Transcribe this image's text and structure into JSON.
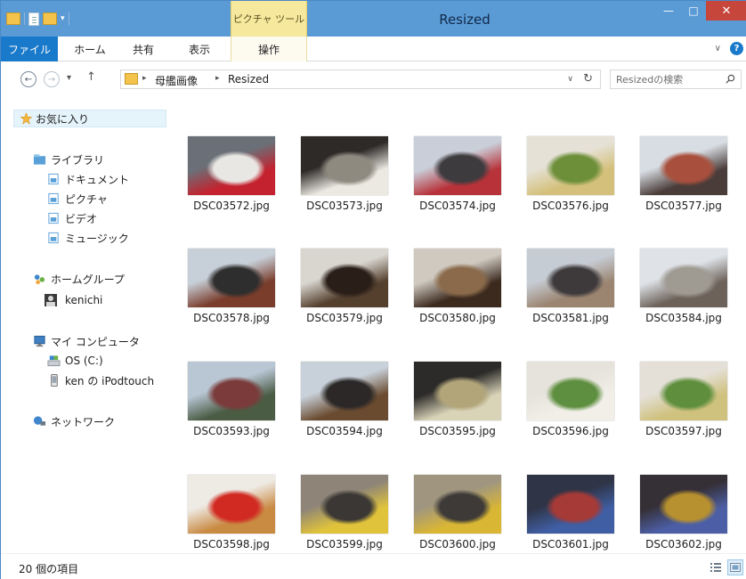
{
  "window": {
    "title": "Resized",
    "tool_tab": "ピクチャ ツール",
    "buttons": {
      "minimize": "—",
      "maximize": "□",
      "close": "✕"
    }
  },
  "ribbon": {
    "tabs": [
      "ファイル",
      "ホーム",
      "共有",
      "表示",
      "操作"
    ],
    "active_tool_tab": "操作",
    "expand": "∨",
    "help": "?"
  },
  "nav": {
    "back": "←",
    "forward": "→",
    "recent": "▾",
    "up": "↑",
    "breadcrumb": [
      "母艦画像",
      "Resized"
    ],
    "breadcrumb_sep": "▸",
    "dropdown": "∨",
    "refresh": "↻",
    "search_placeholder": "Resizedの検索"
  },
  "sidebar": {
    "favorites": "お気に入り",
    "library": "ライブラリ",
    "library_items": [
      "ドキュメント",
      "ピクチャ",
      "ビデオ",
      "ミュージック"
    ],
    "homegroup": "ホームグループ",
    "homegroup_user": "kenichi",
    "computer": "マイ コンピュータ",
    "computer_items": [
      "OS (C:)",
      "ken の iPodtouch"
    ],
    "network": "ネットワーク"
  },
  "files": [
    {
      "name": "DSC03572.jpg",
      "c1": "#6b7078",
      "c2": "#c4222e",
      "c3": "#e9e7e3"
    },
    {
      "name": "DSC03573.jpg",
      "c1": "#2d2a28",
      "c2": "#ece9e2",
      "c3": "#8f8a80"
    },
    {
      "name": "DSC03574.jpg",
      "c1": "#c9ced8",
      "c2": "#b8323a",
      "c3": "#3d3b3e"
    },
    {
      "name": "DSC03576.jpg",
      "c1": "#e5e1d6",
      "c2": "#d4c07a",
      "c3": "#6d8f3a"
    },
    {
      "name": "DSC03577.jpg",
      "c1": "#d8dde3",
      "c2": "#4a3c39",
      "c3": "#a8503d"
    },
    {
      "name": "DSC03578.jpg",
      "c1": "#c7cfd8",
      "c2": "#7a3d2c",
      "c3": "#2f2e2e"
    },
    {
      "name": "DSC03579.jpg",
      "c1": "#d9d6d0",
      "c2": "#55402e",
      "c3": "#2a1f18"
    },
    {
      "name": "DSC03580.jpg",
      "c1": "#cfc9c0",
      "c2": "#3c2a1f",
      "c3": "#8a6a4a"
    },
    {
      "name": "DSC03581.jpg",
      "c1": "#c6ccd4",
      "c2": "#9b8571",
      "c3": "#3e3a3c"
    },
    {
      "name": "DSC03584.jpg",
      "c1": "#dfe3e8",
      "c2": "#6d625a",
      "c3": "#9f9a92"
    },
    {
      "name": "DSC03593.jpg",
      "c1": "#b9c6d4",
      "c2": "#4a5c44",
      "c3": "#7a3b3a"
    },
    {
      "name": "DSC03594.jpg",
      "c1": "#c8d0d9",
      "c2": "#6a4b2f",
      "c3": "#2b2827"
    },
    {
      "name": "DSC03595.jpg",
      "c1": "#2c2b29",
      "c2": "#d9d3b8",
      "c3": "#b2a57a"
    },
    {
      "name": "DSC03596.jpg",
      "c1": "#e6e3dc",
      "c2": "#f1efe8",
      "c3": "#5e8e3f"
    },
    {
      "name": "DSC03597.jpg",
      "c1": "#e4e0d8",
      "c2": "#cfc17e",
      "c3": "#5f8f3d"
    },
    {
      "name": "DSC03598.jpg",
      "c1": "#eeeae4",
      "c2": "#c98a42",
      "c3": "#d12a22"
    },
    {
      "name": "DSC03599.jpg",
      "c1": "#8e8578",
      "c2": "#e0c33a",
      "c3": "#3a3735"
    },
    {
      "name": "DSC03600.jpg",
      "c1": "#a09680",
      "c2": "#d9b634",
      "c3": "#3d3a37"
    },
    {
      "name": "DSC03601.jpg",
      "c1": "#2f3446",
      "c2": "#3f5ea3",
      "c3": "#a63a37"
    },
    {
      "name": "DSC03602.jpg",
      "c1": "#352f36",
      "c2": "#4c5fa6",
      "c3": "#b7902f"
    }
  ],
  "status": {
    "item_count": "20 個の項目"
  }
}
